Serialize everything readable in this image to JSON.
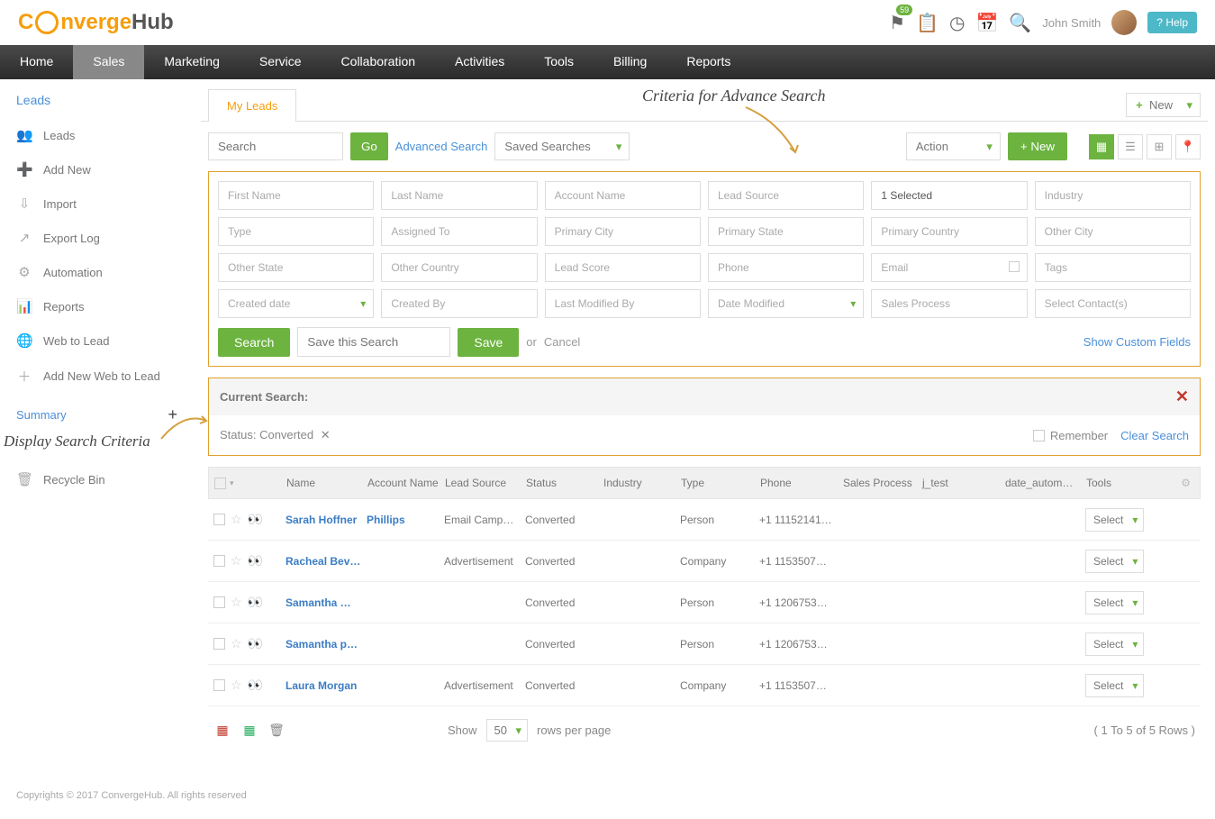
{
  "topbar": {
    "badge": "59",
    "user": "John Smith",
    "help": "Help"
  },
  "nav": [
    "Home",
    "Sales",
    "Marketing",
    "Service",
    "Collaboration",
    "Activities",
    "Tools",
    "Billing",
    "Reports"
  ],
  "sidebar": {
    "title": "Leads",
    "items": [
      "Leads",
      "Add New",
      "Import",
      "Export Log",
      "Automation",
      "Reports",
      "Web to Lead",
      "Add New Web to Lead"
    ],
    "summary": "Summary",
    "recycle": "Recycle Bin"
  },
  "tabs": {
    "myleads": "My Leads",
    "new": "New"
  },
  "toolbar": {
    "search_ph": "Search",
    "go": "Go",
    "advsearch": "Advanced Search",
    "saved": "Saved Searches",
    "action": "Action",
    "new": "+ New"
  },
  "filters": {
    "row1": [
      "First Name",
      "Last Name",
      "Account Name",
      "Lead Source",
      "1 Selected",
      "Industry"
    ],
    "row2": [
      "Type",
      "Assigned To",
      "Primary City",
      "Primary State",
      "Primary Country",
      "Other City"
    ],
    "row3": [
      "Other State",
      "Other Country",
      "Lead Score",
      "Phone",
      "Email",
      "Tags"
    ],
    "row4": [
      "Created date",
      "Created By",
      "Last Modified By",
      "Date Modified",
      "Sales Process",
      "Select Contact(s)"
    ]
  },
  "advactions": {
    "search": "Search",
    "save_ph": "Save this Search",
    "save": "Save",
    "or": "or",
    "cancel": "Cancel",
    "showcustom": "Show Custom Fields"
  },
  "current": {
    "title": "Current Search:",
    "status": "Status: Converted",
    "remember": "Remember",
    "clear": "Clear Search"
  },
  "table": {
    "headers": [
      "",
      "Name",
      "Account Name",
      "Lead Source",
      "Status",
      "Industry",
      "Type",
      "Phone",
      "Sales Process",
      "j_test",
      "date_autom…",
      "Tools"
    ],
    "rows": [
      {
        "name": "Sarah Hoffner",
        "acct": "Phillips",
        "src": "Email Camp…",
        "status": "Converted",
        "industry": "",
        "type": "Person",
        "phone": "+1 11152141…"
      },
      {
        "name": "Racheal Bev…",
        "acct": "",
        "src": "Advertisement",
        "status": "Converted",
        "industry": "",
        "type": "Company",
        "phone": "+1 1153507…"
      },
      {
        "name": "Samantha …",
        "acct": "",
        "src": "",
        "status": "Converted",
        "industry": "",
        "type": "Person",
        "phone": "+1 1206753…"
      },
      {
        "name": "Samantha p…",
        "acct": "",
        "src": "",
        "status": "Converted",
        "industry": "",
        "type": "Person",
        "phone": "+1 1206753…"
      },
      {
        "name": "Laura Morgan",
        "acct": "",
        "src": "Advertisement",
        "status": "Converted",
        "industry": "",
        "type": "Company",
        "phone": "+1 1153507…"
      }
    ],
    "select": "Select"
  },
  "tfoot": {
    "show": "Show",
    "per": "50",
    "rpp": "rows per page",
    "count": "( 1 To 5 of 5 Rows )"
  },
  "annot": {
    "a1": "Criteria for Advance Search",
    "a2": "Display Search Criteria"
  },
  "footer": "Copyrights © 2017 ConvergeHub. All rights reserved"
}
